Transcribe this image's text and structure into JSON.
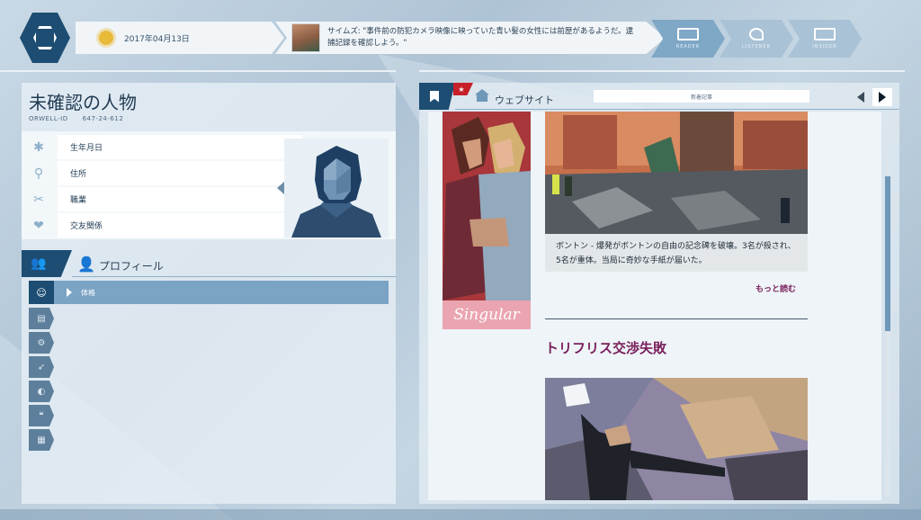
{
  "topbar": {
    "date": "2017年04月13日",
    "message": "サイムズ: \"事件前の防犯カメラ映像に映っていた青い髪の女性には前歴があるようだ。逮捕記録を確認しよう。\"",
    "modes": [
      {
        "label": "READER",
        "icon": "book-icon"
      },
      {
        "label": "LISTENER",
        "icon": "ear-icon"
      },
      {
        "label": "INSIDER",
        "icon": "monitor-icon"
      }
    ]
  },
  "person": {
    "name": "未確認の人物",
    "id_label": "ORWELL-ID",
    "id_value": "647-24-612",
    "fields": [
      {
        "label": "生年月日",
        "icon": "asterisk-icon"
      },
      {
        "label": "住所",
        "icon": "location-pin-icon"
      },
      {
        "label": "職業",
        "icon": "tools-icon"
      },
      {
        "label": "交友関係",
        "icon": "heart-icon"
      }
    ]
  },
  "profile": {
    "title": "プロフィール",
    "active_category": "体格",
    "categories": [
      "face-icon",
      "books-icon",
      "gears-icon",
      "running-icon",
      "silhouette-icon",
      "quote-icon",
      "document-icon"
    ]
  },
  "website": {
    "title": "ウェブサイト",
    "url": "新着記事",
    "ad_text": "Singular",
    "article1_caption": "ボントン - 爆発がボントンの自由の記念碑を破壊。3名が殺され、5名が重体。当局に奇妙な手紙が届いた。",
    "more_link": "もっと読む",
    "headline2": "トリフリス交渉失敗"
  },
  "colors": {
    "accent_dark": "#1d4d72",
    "accent_light": "#7aa3c4",
    "link_purple": "#7a1f5c",
    "alert_red": "#c8202a"
  }
}
